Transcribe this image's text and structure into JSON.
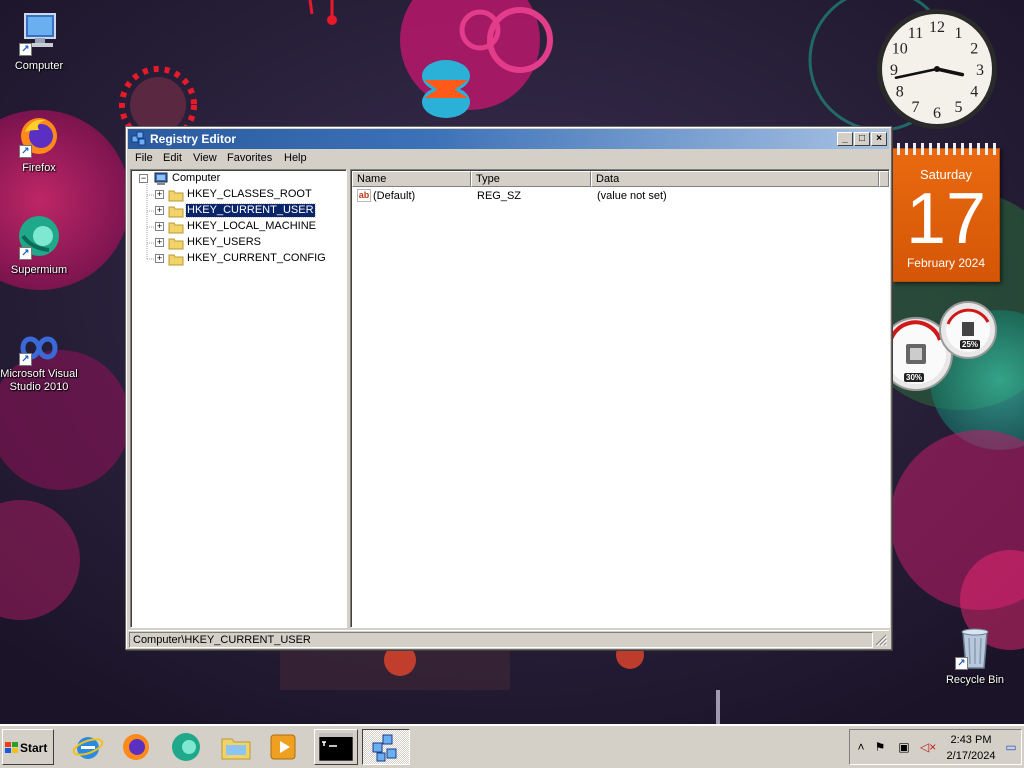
{
  "desktop": {
    "icons": [
      {
        "label": "Computer",
        "icon": "computer-icon"
      },
      {
        "label": "Firefox",
        "icon": "firefox-icon"
      },
      {
        "label": "Supermium",
        "icon": "supermium-icon"
      },
      {
        "label": "Microsoft Visual Studio 2010",
        "icon": "visual-studio-icon"
      },
      {
        "label": "Recycle Bin",
        "icon": "recycle-bin-icon"
      }
    ]
  },
  "gadgets": {
    "clock": {
      "numbers": [
        "12",
        "1",
        "2",
        "3",
        "4",
        "5",
        "6",
        "7",
        "8",
        "9",
        "10",
        "11"
      ],
      "hour_hand": 2.7,
      "minute_hand": 43
    },
    "calendar": {
      "day_name": "Saturday",
      "day_number": "17",
      "month_year": "February 2024"
    },
    "cpu_meter": {
      "cpu_percent": "30%",
      "memory_percent": "25%"
    }
  },
  "window": {
    "title": "Registry Editor",
    "controls": {
      "minimize": "_",
      "maximize": "□",
      "close": "×"
    },
    "menu": [
      "File",
      "Edit",
      "View",
      "Favorites",
      "Help"
    ],
    "tree": {
      "root": "Computer",
      "keys": [
        "HKEY_CLASSES_ROOT",
        "HKEY_CURRENT_USER",
        "HKEY_LOCAL_MACHINE",
        "HKEY_USERS",
        "HKEY_CURRENT_CONFIG"
      ],
      "selected": "HKEY_CURRENT_USER"
    },
    "list": {
      "columns": [
        "Name",
        "Type",
        "Data"
      ],
      "rows": [
        {
          "name": "(Default)",
          "type": "REG_SZ",
          "data": "(value not set)",
          "icon": "ab"
        }
      ]
    },
    "status": "Computer\\HKEY_CURRENT_USER"
  },
  "taskbar": {
    "start_label": "Start",
    "pinned": [
      "internet-explorer-icon",
      "firefox-icon",
      "supermium-icon",
      "file-explorer-icon",
      "media-player-icon",
      "command-prompt-icon",
      "registry-editor-icon"
    ],
    "tray": {
      "time": "2:43 PM",
      "date": "2/17/2024"
    }
  }
}
